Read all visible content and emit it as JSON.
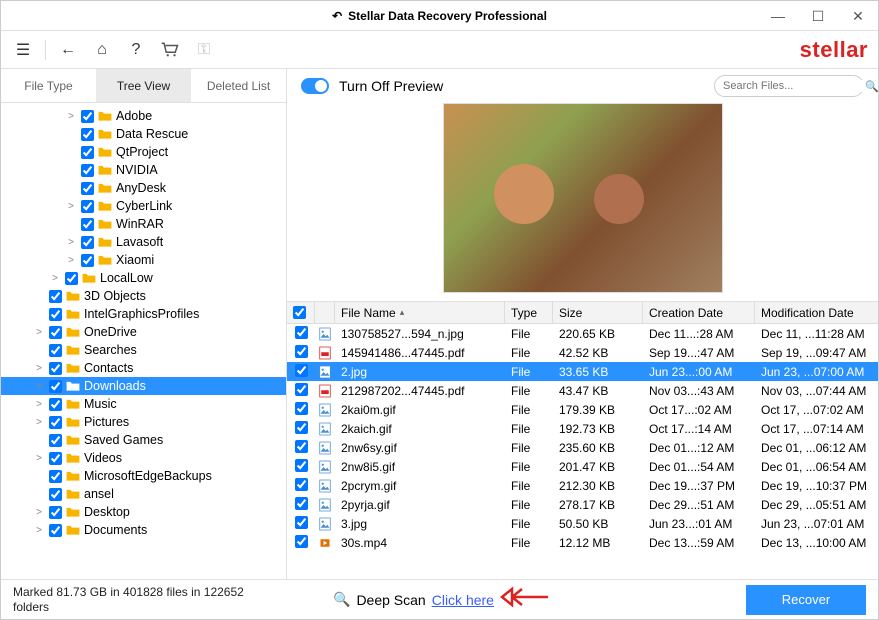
{
  "window": {
    "title": "Stellar Data Recovery Professional"
  },
  "brand": "stellar",
  "tabs": {
    "file_type": "File Type",
    "tree_view": "Tree View",
    "deleted_list": "Deleted List"
  },
  "preview": {
    "toggle_label": "Turn Off Preview",
    "search_placeholder": "Search Files..."
  },
  "tree": [
    {
      "indent": 4,
      "expand": ">",
      "name": "Adobe"
    },
    {
      "indent": 4,
      "expand": "",
      "name": "Data Rescue"
    },
    {
      "indent": 4,
      "expand": "",
      "name": "QtProject"
    },
    {
      "indent": 4,
      "expand": "",
      "name": "NVIDIA"
    },
    {
      "indent": 4,
      "expand": "",
      "name": "AnyDesk"
    },
    {
      "indent": 4,
      "expand": ">",
      "name": "CyberLink"
    },
    {
      "indent": 4,
      "expand": "",
      "name": "WinRAR"
    },
    {
      "indent": 4,
      "expand": ">",
      "name": "Lavasoft"
    },
    {
      "indent": 4,
      "expand": ">",
      "name": "Xiaomi"
    },
    {
      "indent": 3,
      "expand": ">",
      "name": "LocalLow"
    },
    {
      "indent": 2,
      "expand": "",
      "name": "3D Objects"
    },
    {
      "indent": 2,
      "expand": "",
      "name": "IntelGraphicsProfiles"
    },
    {
      "indent": 2,
      "expand": ">",
      "name": "OneDrive"
    },
    {
      "indent": 2,
      "expand": "",
      "name": "Searches"
    },
    {
      "indent": 2,
      "expand": ">",
      "name": "Contacts"
    },
    {
      "indent": 2,
      "expand": ">",
      "name": "Downloads",
      "selected": true
    },
    {
      "indent": 2,
      "expand": ">",
      "name": "Music"
    },
    {
      "indent": 2,
      "expand": ">",
      "name": "Pictures"
    },
    {
      "indent": 2,
      "expand": "",
      "name": "Saved Games"
    },
    {
      "indent": 2,
      "expand": ">",
      "name": "Videos"
    },
    {
      "indent": 2,
      "expand": "",
      "name": "MicrosoftEdgeBackups"
    },
    {
      "indent": 2,
      "expand": "",
      "name": "ansel"
    },
    {
      "indent": 2,
      "expand": ">",
      "name": "Desktop"
    },
    {
      "indent": 2,
      "expand": ">",
      "name": "Documents"
    }
  ],
  "table": {
    "headers": {
      "name": "File Name",
      "type": "Type",
      "size": "Size",
      "cdate": "Creation Date",
      "mdate": "Modification Date"
    },
    "rows": [
      {
        "icon": "img",
        "name": "130758527...594_n.jpg",
        "type": "File",
        "size": "220.65 KB",
        "cdate": "Dec 11...:28 AM",
        "mdate": "Dec 11, ...11:28 AM"
      },
      {
        "icon": "pdf",
        "name": "145941486...47445.pdf",
        "type": "File",
        "size": "42.52 KB",
        "cdate": "Sep 19...:47 AM",
        "mdate": "Sep 19, ...09:47 AM"
      },
      {
        "icon": "img",
        "name": "2.jpg",
        "type": "File",
        "size": "33.65 KB",
        "cdate": "Jun 23...:00 AM",
        "mdate": "Jun 23, ...07:00 AM",
        "selected": true
      },
      {
        "icon": "pdf",
        "name": "212987202...47445.pdf",
        "type": "File",
        "size": "43.47 KB",
        "cdate": "Nov 03...:43 AM",
        "mdate": "Nov 03, ...07:44 AM"
      },
      {
        "icon": "img",
        "name": "2kai0m.gif",
        "type": "File",
        "size": "179.39 KB",
        "cdate": "Oct 17...:02 AM",
        "mdate": "Oct 17, ...07:02 AM"
      },
      {
        "icon": "img",
        "name": "2kaich.gif",
        "type": "File",
        "size": "192.73 KB",
        "cdate": "Oct 17...:14 AM",
        "mdate": "Oct 17, ...07:14 AM"
      },
      {
        "icon": "img",
        "name": "2nw6sy.gif",
        "type": "File",
        "size": "235.60 KB",
        "cdate": "Dec 01...:12 AM",
        "mdate": "Dec 01, ...06:12 AM"
      },
      {
        "icon": "img",
        "name": "2nw8i5.gif",
        "type": "File",
        "size": "201.47 KB",
        "cdate": "Dec 01...:54 AM",
        "mdate": "Dec 01, ...06:54 AM"
      },
      {
        "icon": "img",
        "name": "2pcrym.gif",
        "type": "File",
        "size": "212.30 KB",
        "cdate": "Dec 19...:37 PM",
        "mdate": "Dec 19, ...10:37 PM"
      },
      {
        "icon": "img",
        "name": "2pyrja.gif",
        "type": "File",
        "size": "278.17 KB",
        "cdate": "Dec 29...:51 AM",
        "mdate": "Dec 29, ...05:51 AM"
      },
      {
        "icon": "img",
        "name": "3.jpg",
        "type": "File",
        "size": "50.50 KB",
        "cdate": "Jun 23...:01 AM",
        "mdate": "Jun 23, ...07:01 AM"
      },
      {
        "icon": "vid",
        "name": "30s.mp4",
        "type": "File",
        "size": "12.12 MB",
        "cdate": "Dec 13...:59 AM",
        "mdate": "Dec 13, ...10:00 AM"
      }
    ]
  },
  "footer": {
    "status": "Marked 81.73 GB in 401828 files in 122652 folders",
    "deep_scan": "Deep Scan",
    "click_here": "Click here",
    "recover": "Recover"
  }
}
